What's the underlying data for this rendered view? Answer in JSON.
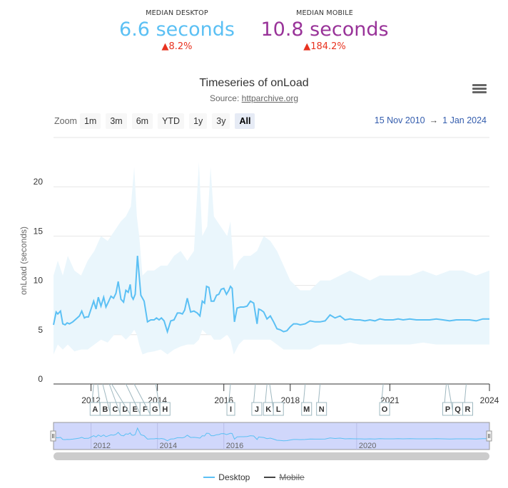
{
  "kpis": {
    "desktop": {
      "label": "MEDIAN DESKTOP",
      "value": "6.6 seconds",
      "change": "▲8.2%",
      "color": "#5bc0f4"
    },
    "mobile": {
      "label": "MEDIAN MOBILE",
      "value": "10.8 seconds",
      "change": "▲184.2%",
      "color": "#993399"
    }
  },
  "chart": {
    "title": "Timeseries of onLoad",
    "source_prefix": "Source: ",
    "source_link": "httparchive.org",
    "menu_icon": "hamburger-menu-icon"
  },
  "zoom": {
    "label": "Zoom",
    "buttons": [
      "1m",
      "3m",
      "6m",
      "YTD",
      "1y",
      "3y",
      "All"
    ],
    "active": "All"
  },
  "range": {
    "from": "15 Nov 2010",
    "arrow": "→",
    "to": "1 Jan 2024"
  },
  "legend": [
    {
      "name": "Desktop",
      "color": "#5bc0f4",
      "visible": true
    },
    {
      "name": "Mobile",
      "color": "#444444",
      "visible": false
    }
  ],
  "navigator": {
    "labels": [
      "2012",
      "2014",
      "2016",
      "2020"
    ]
  },
  "chart_data": {
    "type": "line",
    "title": "Timeseries of onLoad",
    "subtitle": "Source: httparchive.org",
    "ylabel": "onLoad (seconds)",
    "xlabel": "",
    "ylim": [
      0,
      25
    ],
    "yticks": [
      0,
      5,
      10,
      15,
      20
    ],
    "xlim": [
      2010.87,
      2024.0
    ],
    "xticks": [
      {
        "label": "2012",
        "x": 2012.0
      },
      {
        "label": "2014",
        "x": 2014.0
      },
      {
        "label": "2016",
        "x": 2016.0
      },
      {
        "label": "2018",
        "x": 2018.0
      },
      {
        "label": "2021",
        "x": 2021.0
      },
      {
        "label": "2024",
        "x": 2024.0
      }
    ],
    "grid": true,
    "legend_position": "bottom",
    "series": [
      {
        "name": "Desktop",
        "color": "#5bc0f4",
        "x": [
          2010.87,
          2010.95,
          2011.0,
          2011.08,
          2011.15,
          2011.22,
          2011.28,
          2011.35,
          2011.45,
          2011.55,
          2011.65,
          2011.72,
          2011.8,
          2011.85,
          2011.92,
          2012.0,
          2012.08,
          2012.15,
          2012.22,
          2012.3,
          2012.38,
          2012.45,
          2012.52,
          2012.6,
          2012.68,
          2012.75,
          2012.82,
          2012.9,
          2012.98,
          2013.05,
          2013.12,
          2013.18,
          2013.22,
          2013.27,
          2013.33,
          2013.4,
          2013.5,
          2013.6,
          2013.7,
          2013.8,
          2013.9,
          2013.97,
          2014.05,
          2014.12,
          2014.2,
          2014.3,
          2014.4,
          2014.5,
          2014.6,
          2014.68,
          2014.75,
          2014.82,
          2014.9,
          2015.0,
          2015.1,
          2015.2,
          2015.28,
          2015.35,
          2015.42,
          2015.48,
          2015.55,
          2015.62,
          2015.7,
          2015.78,
          2015.85,
          2015.92,
          2016.0,
          2016.08,
          2016.15,
          2016.2,
          2016.25,
          2016.32,
          2016.4,
          2016.5,
          2016.6,
          2016.7,
          2016.8,
          2016.9,
          2017.0,
          2017.05,
          2017.12,
          2017.2,
          2017.3,
          2017.4,
          2017.5,
          2017.6,
          2017.7,
          2017.8,
          2017.9,
          2018.0,
          2018.1,
          2018.2,
          2018.3,
          2018.45,
          2018.6,
          2018.75,
          2018.9,
          2019.05,
          2019.2,
          2019.35,
          2019.5,
          2019.65,
          2019.8,
          2019.95,
          2020.1,
          2020.25,
          2020.4,
          2020.55,
          2020.7,
          2020.85,
          2021.0,
          2021.1,
          2021.25,
          2021.4,
          2021.6,
          2021.8,
          2022.0,
          2022.2,
          2022.4,
          2022.6,
          2022.8,
          2023.0,
          2023.2,
          2023.4,
          2023.6,
          2023.8,
          2024.0
        ],
        "y": [
          6.0,
          7.3,
          7.1,
          7.4,
          6.1,
          6.0,
          6.2,
          6.1,
          6.3,
          6.6,
          6.9,
          7.4,
          6.7,
          6.8,
          6.8,
          7.6,
          8.4,
          7.6,
          8.8,
          7.9,
          8.8,
          7.8,
          8.3,
          8.9,
          8.7,
          9.2,
          10.4,
          8.6,
          8.3,
          9.5,
          9.3,
          10.1,
          8.9,
          8.6,
          9.1,
          13.0,
          9.0,
          8.4,
          6.3,
          6.5,
          6.5,
          6.7,
          6.5,
          6.7,
          6.4,
          5.3,
          6.4,
          6.5,
          7.2,
          7.2,
          7.1,
          7.5,
          8.7,
          7.3,
          7.4,
          7.2,
          6.9,
          8.4,
          8.2,
          9.9,
          9.8,
          8.4,
          8.4,
          9.0,
          9.1,
          9.6,
          9.7,
          9.1,
          9.5,
          9.9,
          9.7,
          6.3,
          7.7,
          7.8,
          7.8,
          7.9,
          8.4,
          8.2,
          6.1,
          7.6,
          7.5,
          7.3,
          6.6,
          6.9,
          6.3,
          5.6,
          5.5,
          5.3,
          5.4,
          5.8,
          6.1,
          6.1,
          6.0,
          6.1,
          6.4,
          6.3,
          6.3,
          6.4,
          7.0,
          6.7,
          6.9,
          6.5,
          6.6,
          6.5,
          6.5,
          6.4,
          6.5,
          6.4,
          6.6,
          6.5,
          6.5,
          6.5,
          6.6,
          6.5,
          6.6,
          6.5,
          6.5,
          6.5,
          6.6,
          6.5,
          6.4,
          6.5,
          6.5,
          6.5,
          6.4,
          6.6,
          6.6
        ]
      }
    ],
    "band": {
      "name": "Desktop range",
      "color": "#eaf6fc",
      "x": [
        2010.87,
        2011.0,
        2011.15,
        2011.3,
        2011.5,
        2011.7,
        2011.9,
        2012.1,
        2012.3,
        2012.5,
        2012.7,
        2012.9,
        2013.05,
        2013.2,
        2013.3,
        2013.38,
        2013.45,
        2013.55,
        2013.7,
        2013.9,
        2014.1,
        2014.3,
        2014.5,
        2014.7,
        2014.9,
        2015.1,
        2015.25,
        2015.35,
        2015.5,
        2015.6,
        2015.7,
        2015.9,
        2016.1,
        2016.2,
        2016.3,
        2016.45,
        2016.6,
        2016.8,
        2017.0,
        2017.2,
        2017.4,
        2017.6,
        2017.8,
        2018.0,
        2018.3,
        2018.6,
        2018.9,
        2019.2,
        2019.5,
        2019.8,
        2020.1,
        2020.4,
        2020.7,
        2021.0,
        2021.3,
        2021.6,
        2022.0,
        2022.4,
        2022.8,
        2023.2,
        2023.6,
        2024.0
      ],
      "upper": [
        11,
        12.5,
        11,
        13,
        11.5,
        11,
        12.5,
        13.5,
        15,
        14.5,
        15.5,
        16.5,
        17,
        18,
        22,
        17,
        15,
        11,
        11.5,
        11.5,
        12,
        12,
        13,
        13.5,
        12.5,
        13.5,
        22.5,
        15,
        16,
        22,
        17,
        16,
        15,
        16.5,
        11.5,
        12.5,
        13,
        13,
        13.5,
        15,
        14.5,
        13.5,
        12,
        10.5,
        9.5,
        9.5,
        10.5,
        10.5,
        11,
        11.5,
        11,
        10.5,
        11,
        11,
        11,
        11,
        11.5,
        11,
        11.5,
        11.5,
        11,
        11.5
      ],
      "lower": [
        3,
        4,
        3.5,
        4,
        3.3,
        3.5,
        3.5,
        4,
        4.5,
        4.2,
        5,
        5,
        4.5,
        5,
        5.5,
        5,
        4,
        3,
        3.2,
        3.3,
        3.5,
        3,
        3.5,
        3.8,
        4,
        4,
        4.5,
        5.5,
        5,
        5,
        4.5,
        4.5,
        5,
        4.5,
        3,
        4,
        4.5,
        4.5,
        4.5,
        4.5,
        4.5,
        4,
        3.5,
        3.5,
        3.5,
        3.5,
        4,
        4,
        4,
        4.2,
        4,
        4,
        4,
        4,
        4,
        4,
        4.2,
        4,
        4,
        4,
        4,
        4
      ]
    },
    "flags": [
      {
        "label": "A",
        "x": 2012.08
      },
      {
        "label": "B",
        "x": 2012.2
      },
      {
        "label": "C",
        "x": 2012.35
      },
      {
        "label": "D",
        "x": 2012.55
      },
      {
        "label": "E",
        "x": 2012.62
      },
      {
        "label": "F",
        "x": 2013.05
      },
      {
        "label": "G",
        "x": 2013.3
      },
      {
        "label": "H",
        "x": 2013.95
      },
      {
        "label": "I",
        "x": 2016.2
      },
      {
        "label": "J",
        "x": 2016.95
      },
      {
        "label": "K",
        "x": 2017.3
      },
      {
        "label": "L",
        "x": 2017.38
      },
      {
        "label": "M",
        "x": 2018.45
      },
      {
        "label": "N",
        "x": 2018.9
      },
      {
        "label": "O",
        "x": 2020.8
      },
      {
        "label": "P",
        "x": 2022.7
      },
      {
        "label": "Q",
        "x": 2022.75
      },
      {
        "label": "R",
        "x": 2023.3
      }
    ]
  }
}
